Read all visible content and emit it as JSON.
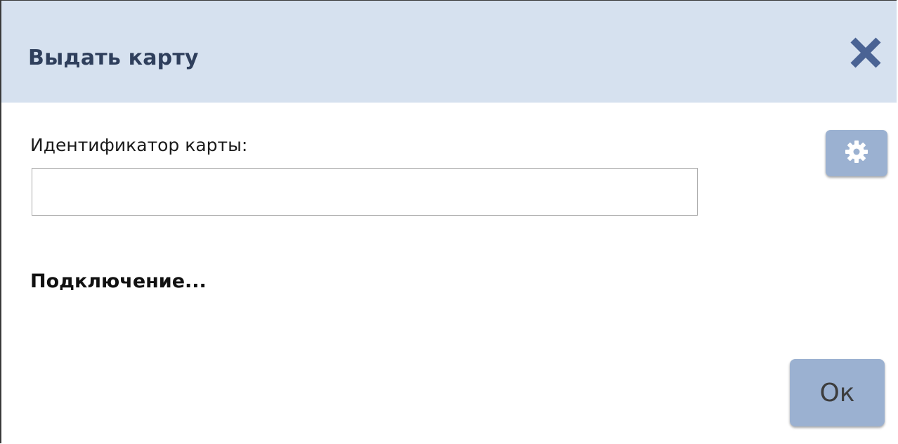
{
  "dialog": {
    "title": "Выдать карту",
    "close_icon": "close-icon",
    "settings_icon": "gear-icon"
  },
  "form": {
    "card_id_label": "Идентификатор карты:",
    "card_id_value": "",
    "card_id_placeholder": ""
  },
  "status": {
    "text": "Подключение..."
  },
  "actions": {
    "ok_label": "Ок"
  },
  "colors": {
    "header_bg": "#d6e1ef",
    "title_color": "#2f3f5c",
    "button_bg": "#9bb1d1",
    "close_icon_color": "#4a6394"
  }
}
